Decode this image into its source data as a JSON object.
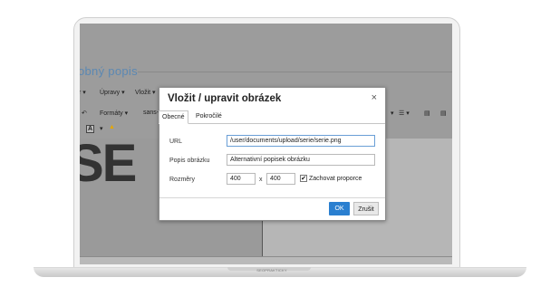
{
  "editor": {
    "page_title": "obný popis",
    "menu": [
      "r ▾",
      "Úpravy ▾",
      "Vložit ▾"
    ],
    "toolbar": {
      "formats_label": "Formáty ▾",
      "font_label": "sans-",
      "list_icon": "☰ ▾",
      "big_text": "SE"
    }
  },
  "modal": {
    "title": "Vložit / upravit obrázek",
    "close": "×",
    "tabs": [
      "Obecné",
      "Pokročilé"
    ],
    "active_tab": "Obecné",
    "fields": {
      "url": {
        "label": "URL",
        "value": "/user/documents/upload/serie/serie.png"
      },
      "alt": {
        "label": "Popis obrázku",
        "value": "Alternativní popisek obrázku"
      },
      "size": {
        "label": "Rozměry",
        "width": "400",
        "height": "400",
        "separator": "x"
      }
    },
    "keep_proportions": {
      "checked": true,
      "label": "Zachovat proporce"
    },
    "ok_label": "OK",
    "cancel_label": "Zrušit"
  },
  "laptop": {
    "brand_text": "SEOPRAKTICKY"
  }
}
